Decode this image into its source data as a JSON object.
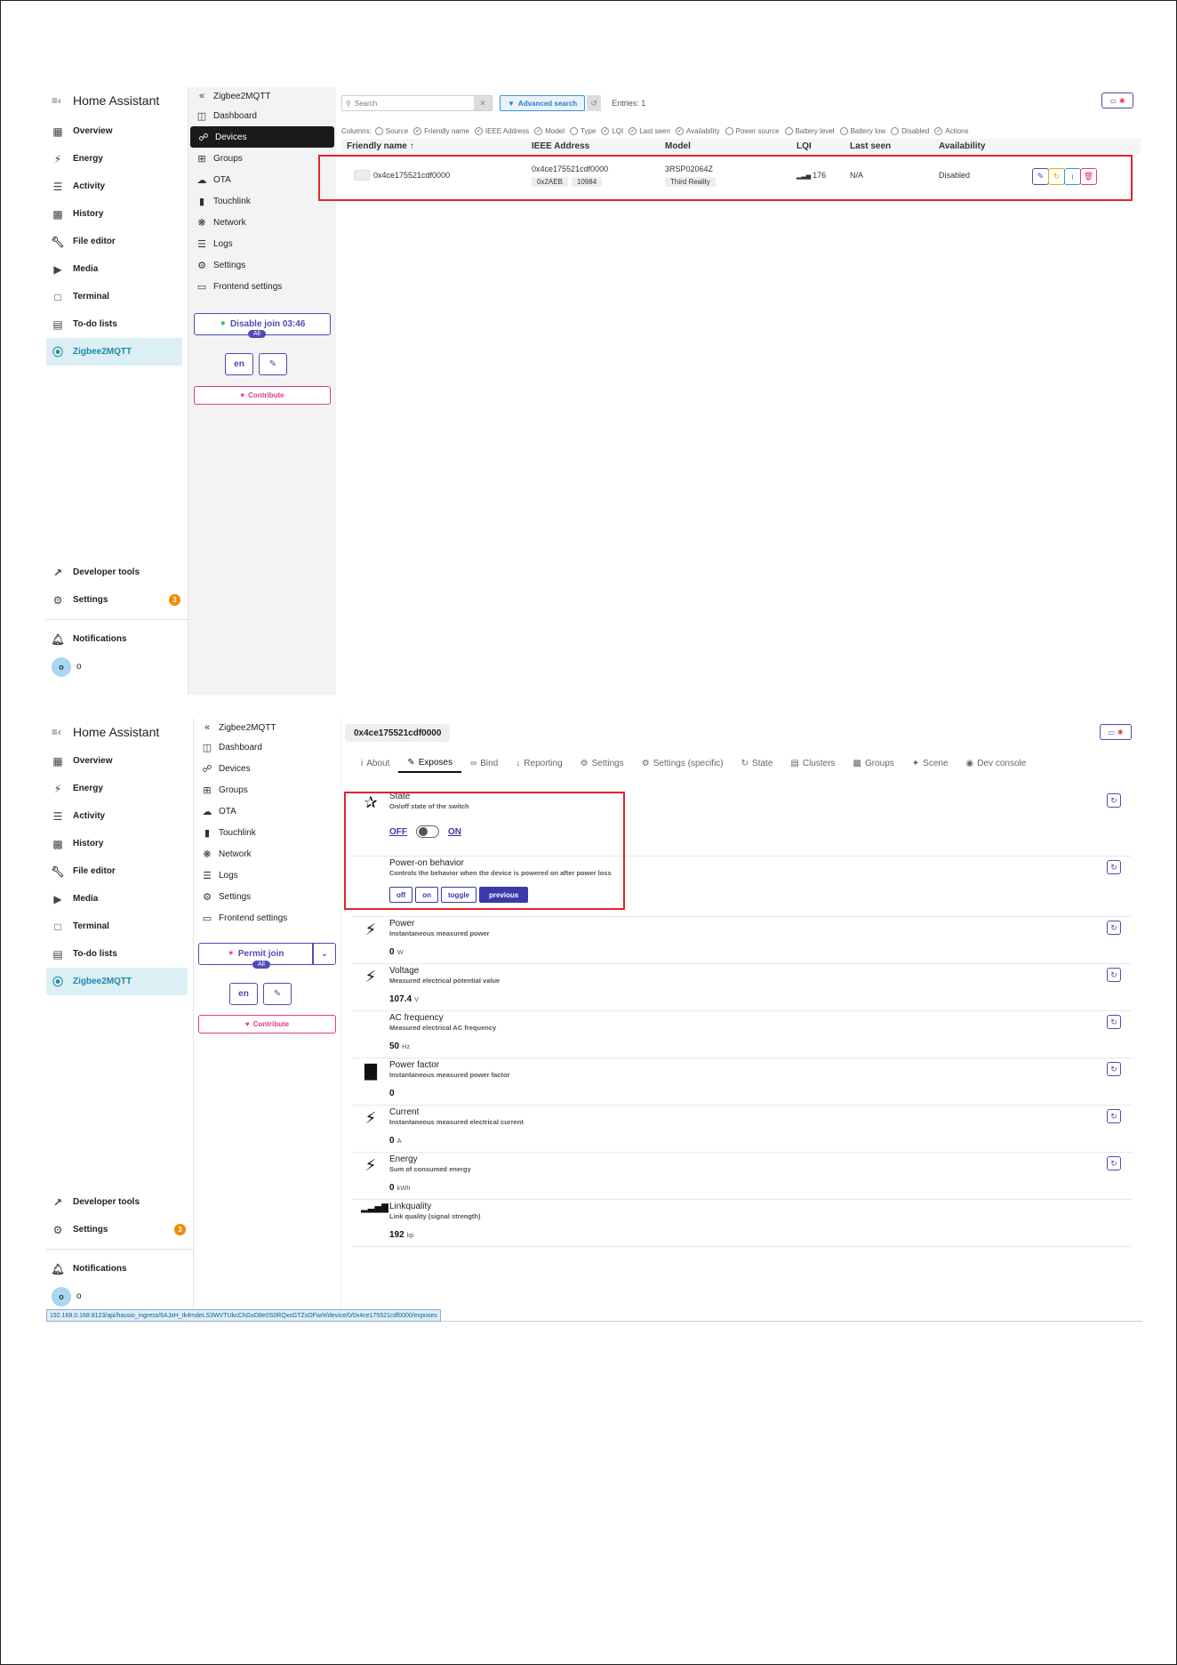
{
  "ha": {
    "title": "Home Assistant",
    "nav": [
      {
        "label": "Overview",
        "icon": "dashboard-icon"
      },
      {
        "label": "Energy",
        "icon": "bolt-icon"
      },
      {
        "label": "Activity",
        "icon": "list-icon"
      },
      {
        "label": "History",
        "icon": "chart-icon"
      },
      {
        "label": "File editor",
        "icon": "wrench-icon"
      },
      {
        "label": "Media",
        "icon": "media-icon"
      },
      {
        "label": "Terminal",
        "icon": "terminal-icon"
      },
      {
        "label": "To-do lists",
        "icon": "clipboard-icon"
      },
      {
        "label": "Zigbee2MQTT",
        "icon": "zigbee-icon"
      }
    ],
    "developer_tools": "Developer tools",
    "settings": "Settings",
    "settings_badge": "3",
    "notifications": "Notifications",
    "user_initial": "o",
    "user_name": "o"
  },
  "z2m": {
    "back_label": "Zigbee2MQTT",
    "nav": [
      {
        "label": "Dashboard",
        "icon": "dashboard-icon"
      },
      {
        "label": "Devices",
        "icon": "plug-icon"
      },
      {
        "label": "Groups",
        "icon": "grid-icon"
      },
      {
        "label": "OTA",
        "icon": "cloud-icon"
      },
      {
        "label": "Touchlink",
        "icon": "touchlink-icon"
      },
      {
        "label": "Network",
        "icon": "network-icon"
      },
      {
        "label": "Logs",
        "icon": "list-icon"
      },
      {
        "label": "Settings",
        "icon": "gears-icon"
      },
      {
        "label": "Frontend settings",
        "icon": "monitor-icon"
      }
    ],
    "disable_join": "Disable join 03:46",
    "permit_join": "Permit join",
    "all_pill": "All",
    "lang_button": "en",
    "contribute": "Contribute"
  },
  "devices_view": {
    "search_placeholder": "Search",
    "advanced_search": "Advanced search",
    "entries": "Entries: 1",
    "columns_label": "Columns:",
    "columns": [
      {
        "label": "Source",
        "checked": false
      },
      {
        "label": "Friendly name",
        "checked": true
      },
      {
        "label": "IEEE Address",
        "checked": true
      },
      {
        "label": "Model",
        "checked": true
      },
      {
        "label": "Type",
        "checked": false
      },
      {
        "label": "LQI",
        "checked": true
      },
      {
        "label": "Last seen",
        "checked": true
      },
      {
        "label": "Availability",
        "checked": true
      },
      {
        "label": "Power source",
        "checked": false
      },
      {
        "label": "Battery level",
        "checked": false
      },
      {
        "label": "Battery low",
        "checked": false
      },
      {
        "label": "Disabled",
        "checked": false
      },
      {
        "label": "Actions",
        "checked": true
      }
    ],
    "headers": {
      "friendly_name": "Friendly name ↑",
      "ieee": "IEEE Address",
      "model": "Model",
      "lqi": "LQI",
      "last_seen": "Last seen",
      "availability": "Availability"
    },
    "row": {
      "friendly_name": "0x4ce175521cdf0000",
      "ieee": "0x4ce175521cdf0000",
      "nwk": "0x2AEB",
      "nwk_dec": "10984",
      "model": "3RSP02064Z",
      "vendor": "Third Reality",
      "lqi": "176",
      "last_seen": "N/A",
      "availability": "Disabled"
    },
    "accent": "#e0242b"
  },
  "device_view": {
    "device_name": "0x4ce175521cdf0000",
    "tabs": [
      {
        "label": "About",
        "icon": "info-icon"
      },
      {
        "label": "Exposes",
        "icon": "pencil-icon",
        "active": true
      },
      {
        "label": "Bind",
        "icon": "link-icon"
      },
      {
        "label": "Reporting",
        "icon": "download-icon"
      },
      {
        "label": "Settings",
        "icon": "gears-icon"
      },
      {
        "label": "Settings (specific)",
        "icon": "gear-icon"
      },
      {
        "label": "State",
        "icon": "sync-icon"
      },
      {
        "label": "Clusters",
        "icon": "clusters-icon"
      },
      {
        "label": "Groups",
        "icon": "groups-icon"
      },
      {
        "label": "Scene",
        "icon": "wand-icon"
      },
      {
        "label": "Dev console",
        "icon": "bug-icon"
      }
    ],
    "state": {
      "name": "State",
      "desc": "On/off state of the switch",
      "off_label": "OFF",
      "on_label": "ON"
    },
    "power_on": {
      "name": "Power-on behavior",
      "desc": "Controls the behavior when the device is powered on after power loss",
      "options": [
        "off",
        "on",
        "toggle",
        "previous"
      ],
      "selected": "previous"
    },
    "exposes": [
      {
        "name": "Power",
        "desc": "Instantaneous measured power",
        "value": "0",
        "unit": "W",
        "icon": "bolt-icon"
      },
      {
        "name": "Voltage",
        "desc": "Measured electrical potential value",
        "value": "107.4",
        "unit": "V",
        "icon": "bolt-icon"
      },
      {
        "name": "AC frequency",
        "desc": "Measured electrical AC frequency",
        "value": "50",
        "unit": "Hz",
        "icon": ""
      },
      {
        "name": "Power factor",
        "desc": "Instantaneous measured power factor",
        "value": "0",
        "unit": "",
        "icon": "factory-icon"
      },
      {
        "name": "Current",
        "desc": "Instantaneous measured electrical current",
        "value": "0",
        "unit": "A",
        "icon": "bolt-icon"
      },
      {
        "name": "Energy",
        "desc": "Sum of consumed energy",
        "value": "0",
        "unit": "kWh",
        "icon": "bolt-icon"
      },
      {
        "name": "Linkquality",
        "desc": "Link quality (signal strength)",
        "value": "192",
        "unit": "lqi",
        "icon": "signal-icon"
      }
    ],
    "status_url": "192.168.0.168:8123/api/hassio_ingress/6AJxH_tk4mdeLS3WVTUkcChGsO8e0S0RQxsGTZsOFw/#/device/0/0x4ce175521cdf0000/exposes"
  }
}
